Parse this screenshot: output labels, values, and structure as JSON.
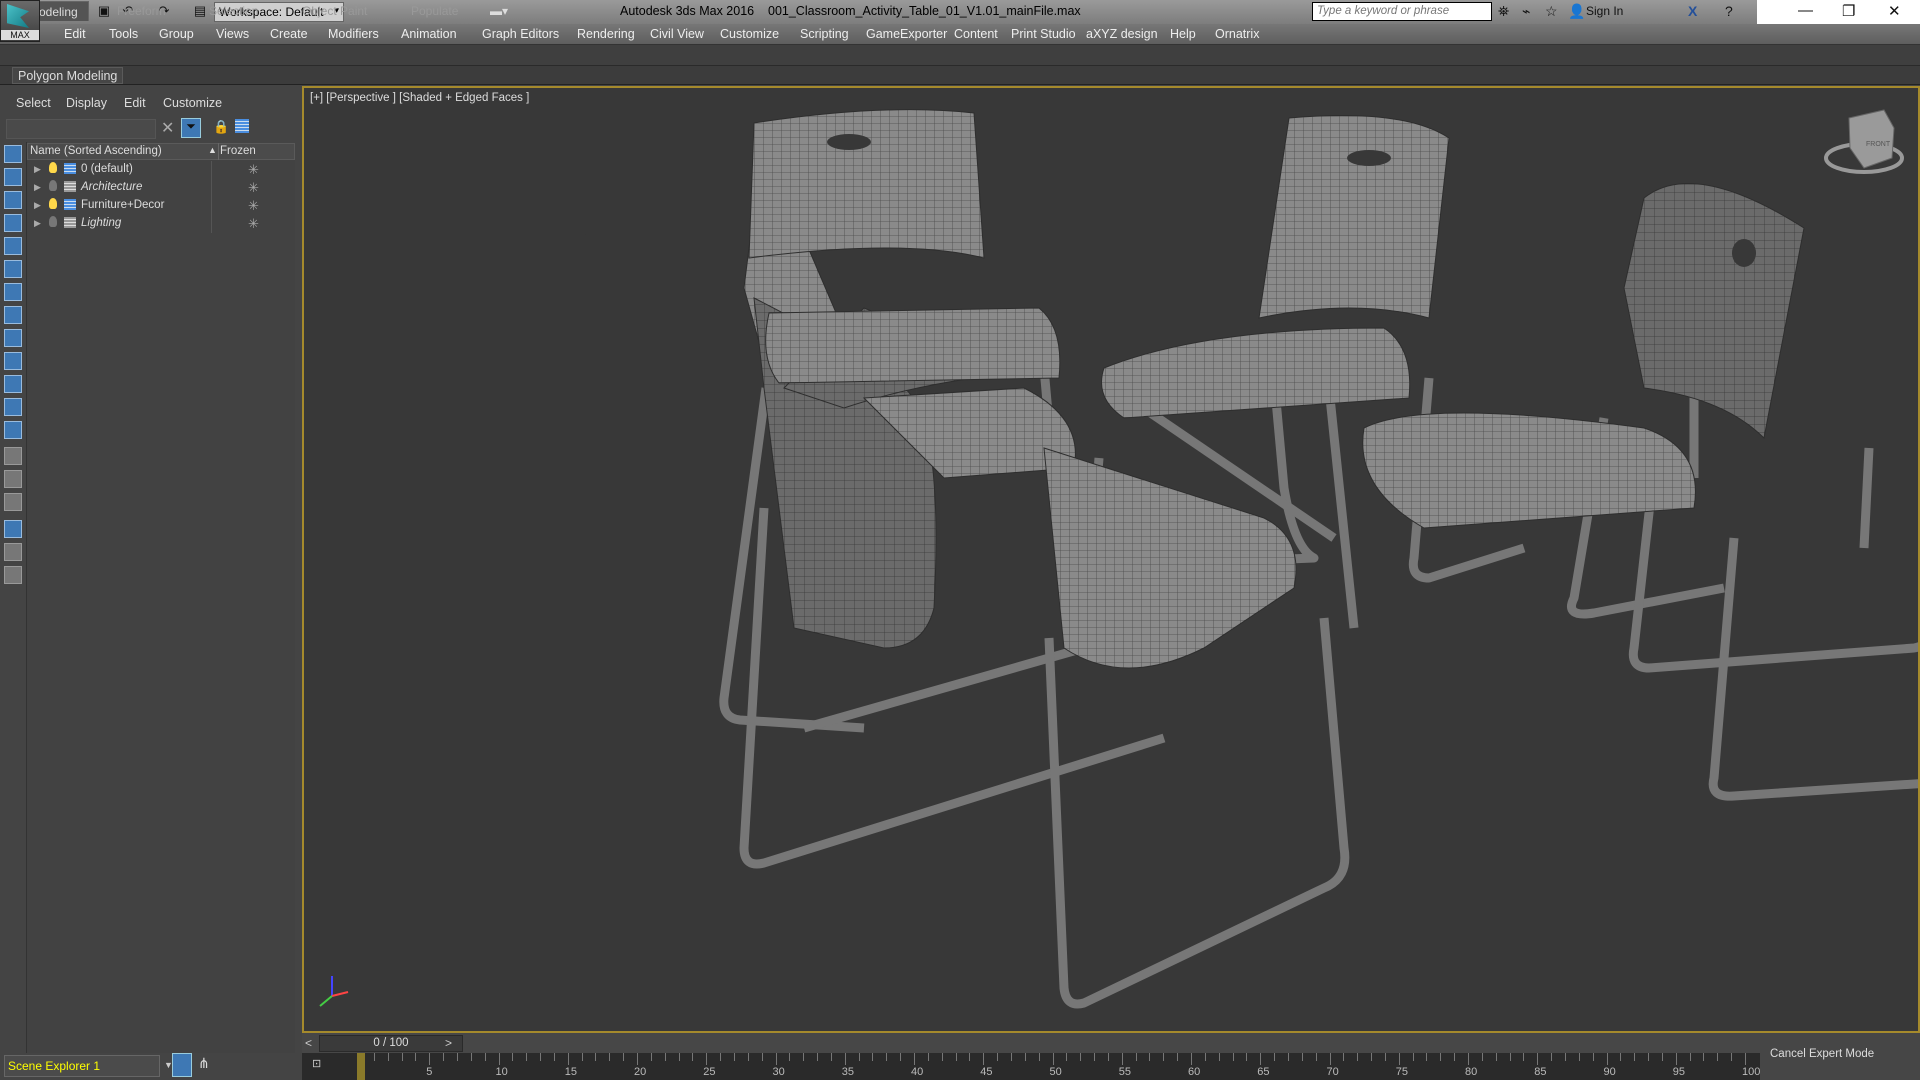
{
  "app": {
    "logo_label": "MAX",
    "title": "Autodesk 3ds Max 2016    001_Classroom_Activity_Table_01_V1.01_mainFile.max",
    "workspace": "Workspace: Default",
    "search_placeholder": "Type a keyword or phrase",
    "sign_in": "Sign In"
  },
  "menu": [
    "Edit",
    "Tools",
    "Group",
    "Views",
    "Create",
    "Modifiers",
    "Animation",
    "Graph Editors",
    "Rendering",
    "Civil View",
    "Customize",
    "Scripting",
    "GameExporter",
    "Content",
    "Print Studio",
    "aXYZ design",
    "Help",
    "Ornatrix"
  ],
  "ribbon": {
    "tabs": [
      "Modeling",
      "Freeform",
      "Selection",
      "Object Paint",
      "Populate"
    ],
    "active": "Modeling",
    "panel": "Polygon Modeling"
  },
  "explorer": {
    "menu": [
      "Select",
      "Display",
      "Edit",
      "Customize"
    ],
    "col_name": "Name (Sorted Ascending)",
    "col_frozen": "Frozen",
    "layers": [
      {
        "name": "0 (default)",
        "italic": false,
        "on": true
      },
      {
        "name": "Architecture",
        "italic": true,
        "on": false
      },
      {
        "name": "Furniture+Decor",
        "italic": false,
        "on": true
      },
      {
        "name": "Lighting",
        "italic": true,
        "on": false
      }
    ],
    "name": "Scene Explorer 1"
  },
  "viewport": {
    "label": "[+] [Perspective ] [Shaded + Edged Faces ]",
    "viewcube": "FRONT"
  },
  "timeline": {
    "frame": "0 / 100",
    "current": 0,
    "end": 100,
    "labels": [
      "0",
      "5",
      "10",
      "15",
      "20",
      "25",
      "30",
      "35",
      "40",
      "45",
      "50",
      "55",
      "60",
      "65",
      "70",
      "75",
      "80",
      "85",
      "90",
      "95",
      "100"
    ]
  },
  "status": {
    "cancel_expert": "Cancel Expert Mode"
  },
  "colors": {
    "viewport_border": "#a58a2c",
    "viewport_bg": "#383838",
    "scene_explorer_name": "#ffff00"
  }
}
